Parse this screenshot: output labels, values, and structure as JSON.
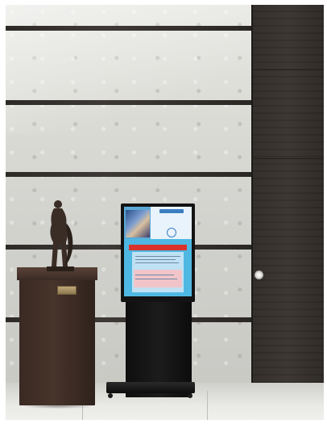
{
  "photo": {
    "subject": "",
    "colors": {
      "stone": "#d9d9d4",
      "wood_panel": "#35302c",
      "pedestal": "#3f2e26",
      "kiosk_frame": "#131313",
      "screen": "#4fb8e2"
    }
  }
}
